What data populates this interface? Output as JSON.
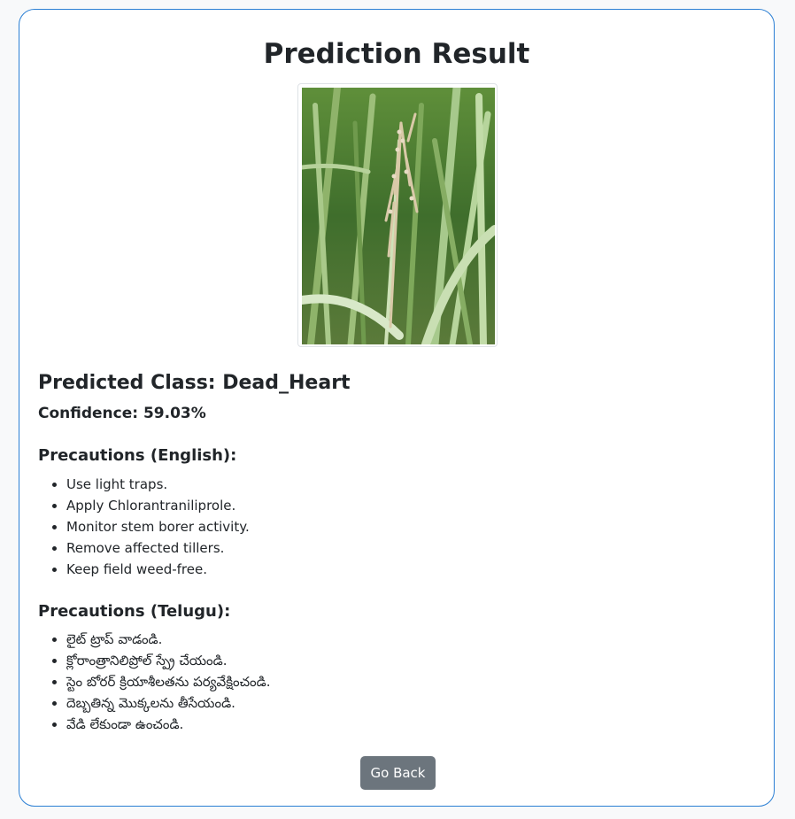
{
  "page": {
    "title": "Prediction Result"
  },
  "image": {
    "subject": "rice-plant-photo"
  },
  "result": {
    "predicted_class": "Predicted Class: Dead_Heart",
    "confidence": "Confidence: 59.03%"
  },
  "precautions_english": {
    "heading": "Precautions (English):",
    "items": [
      "Use light traps.",
      "Apply Chlorantraniliprole.",
      "Monitor stem borer activity.",
      "Remove affected tillers.",
      "Keep field weed-free."
    ]
  },
  "precautions_telugu": {
    "heading": "Precautions (Telugu):",
    "items": [
      "లైట్ ట్రాప్ వాడండి.",
      "క్లోరాంత్రానిలిప్రోల్ స్ప్రే చేయండి.",
      "స్టెం బోరర్ క్రియాశీలతను పర్యవేక్షించండి.",
      "దెబ్బతిన్న మొక్కలను తీసేయండి.",
      "వేడి లేకుండా ఉంచండి."
    ]
  },
  "actions": {
    "back_label": "Go Back"
  },
  "colors": {
    "card_border": "#2b7fd4",
    "button_bg": "#6c757d",
    "background": "#f8f9fa"
  }
}
